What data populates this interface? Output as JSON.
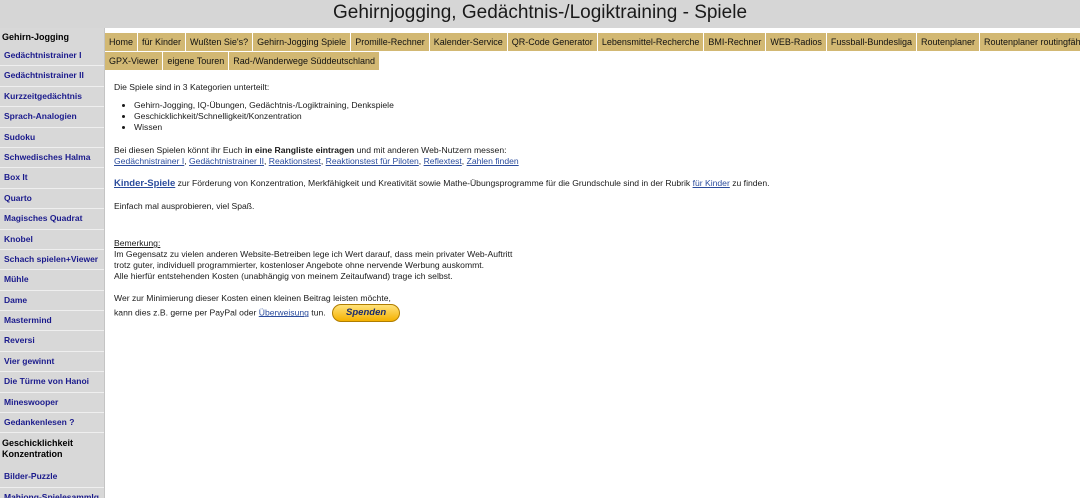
{
  "page_title": "Gehirnjogging, Gedächtnis-/Logiktraining - Spiele",
  "sidebar": {
    "heading1": "Gehirn-Jogging",
    "items1": [
      "Gedächtnistrainer I",
      "Gedächtnistrainer II",
      "Kurzzeitgedächtnis",
      "Sprach-Analogien",
      "Sudoku",
      "Schwedisches Halma",
      "Box It",
      "Quarto",
      "Magisches Quadrat",
      "Knobel",
      "Schach spielen+Viewer",
      "Mühle",
      "Dame",
      "Mastermind",
      "Reversi",
      "Vier gewinnt",
      "Die Türme von Hanoi",
      "Mineswooper",
      "Gedankenlesen ?"
    ],
    "heading2_line1": "Geschicklichkeit",
    "heading2_line2": "Konzentration",
    "items2": [
      "Bilder-Puzzle",
      "Mahjong-Spielesammlg"
    ]
  },
  "nav": {
    "row1": [
      "Home",
      "für Kinder",
      "Wußten Sie's?",
      "Gehirn-Jogging Spiele",
      "Promille-Rechner",
      "Kalender-Service",
      "QR-Code Generator",
      "Lebensmittel-Recherche",
      "BMI-Rechner",
      "WEB-Radios",
      "Fussball-Bundesliga",
      "Routenplaner",
      "Routenplaner routingfähig"
    ],
    "row2": [
      "GPX-Viewer",
      "eigene Touren",
      "Rad-/Wanderwege Süddeutschland"
    ]
  },
  "content": {
    "intro": "Die Spiele sind in 3 Kategorien unterteilt:",
    "categories": [
      "Gehirn-Jogging, IQ-Übungen, Gedächtnis-/Logiktraining, Denkspiele",
      "Geschicklichkeit/Schnelligkeit/Konzentration",
      "Wissen"
    ],
    "rank_pre": "Bei diesen Spielen könnt ihr Euch ",
    "rank_bold": "in eine Rangliste eintragen",
    "rank_post": " und mit anderen Web-Nutzern messen:",
    "rank_links": [
      "Gedächnistrainer I",
      "Gedächtnistrainer II",
      "Reaktionstest",
      "Reaktionstest für Piloten",
      "Reflextest",
      "Zahlen finden"
    ],
    "rank_sep": ", ",
    "kids_link": "Kinder-Spiele",
    "kids_text": " zur Förderung von Konzentration, Merkfähigkeit und Kreativität sowie Mathe-Übungsprogramme für die Grundschule sind in der Rubrik ",
    "kids_link2": "für Kinder",
    "kids_end": " zu finden.",
    "tryit": "Einfach mal ausprobieren, viel Spaß.",
    "remark_title": "Bemerkung:",
    "remark_l1": "Im Gegensatz zu vielen anderen Website-Betreiben lege ich Wert darauf, dass mein privater Web-Auftritt",
    "remark_l2": "trotz guter, individuell programmierter, kostenloser Angebote ohne nervende Werbung auskommt.",
    "remark_l3": "Alle hierfür entstehenden Kosten (unabhängig von meinem Zeitaufwand) trage ich selbst.",
    "donate_l1": "Wer zur Minimierung dieser Kosten einen kleinen Beitrag leisten möchte,",
    "donate_l2_pre": "kann dies z.B. gerne per PayPal oder ",
    "donate_link": "Überweisung",
    "donate_l2_post": " tun.",
    "donate_button": "Spenden"
  }
}
